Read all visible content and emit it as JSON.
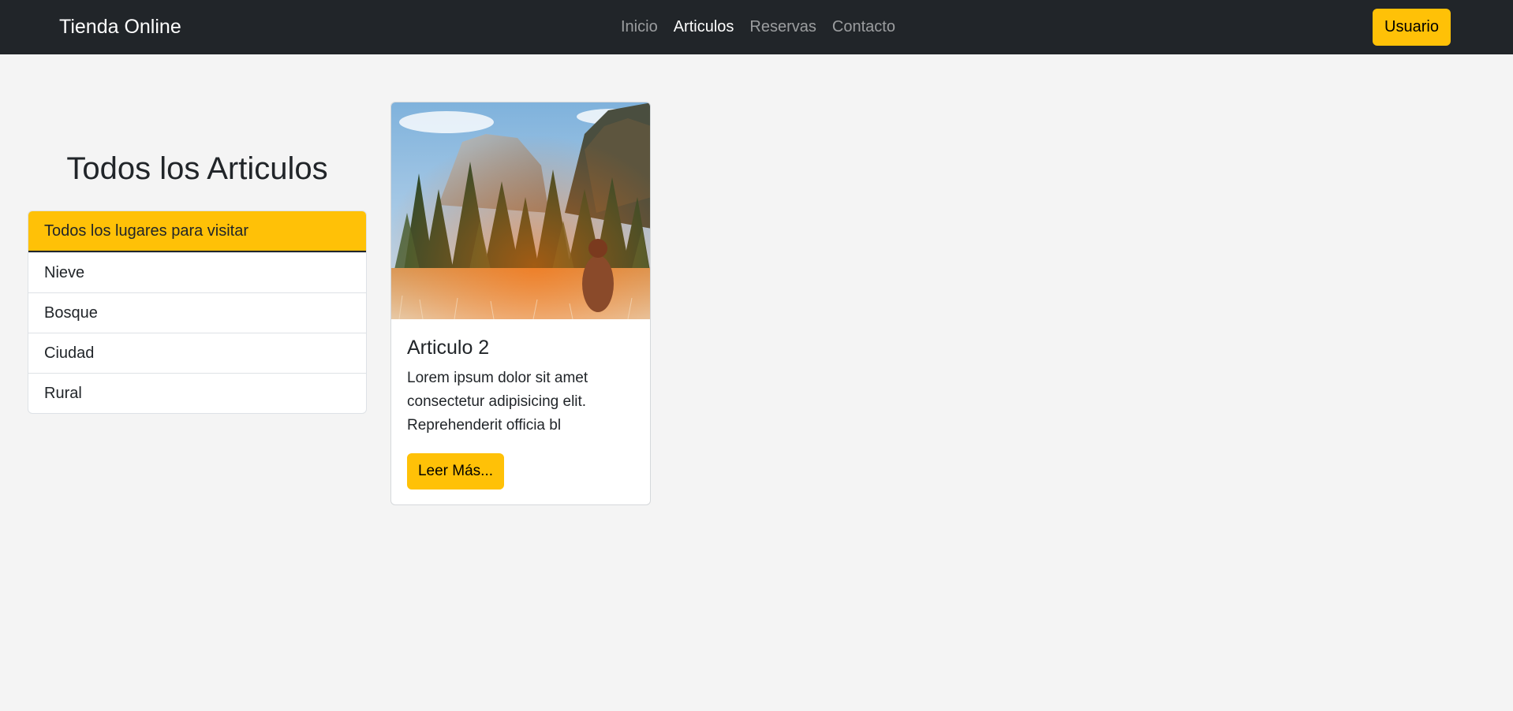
{
  "navbar": {
    "brand": "Tienda Online",
    "links": [
      {
        "label": "Inicio",
        "active": false
      },
      {
        "label": "Articulos",
        "active": true
      },
      {
        "label": "Reservas",
        "active": false
      },
      {
        "label": "Contacto",
        "active": false
      }
    ],
    "user_button": "Usuario"
  },
  "sidebar": {
    "title": "Todos los Articulos",
    "items": [
      {
        "label": "Todos los lugares para visitar",
        "active": true
      },
      {
        "label": "Nieve",
        "active": false
      },
      {
        "label": "Bosque",
        "active": false
      },
      {
        "label": "Ciudad",
        "active": false
      },
      {
        "label": "Rural",
        "active": false
      }
    ]
  },
  "card": {
    "title": "Articulo 2",
    "text": "Lorem ipsum dolor sit amet consectetur adipisicing elit. Reprehenderit officia bl",
    "button": "Leer Más..."
  },
  "colors": {
    "navbar_bg": "#212529",
    "accent": "#ffc107",
    "page_bg": "#f4f4f4"
  }
}
